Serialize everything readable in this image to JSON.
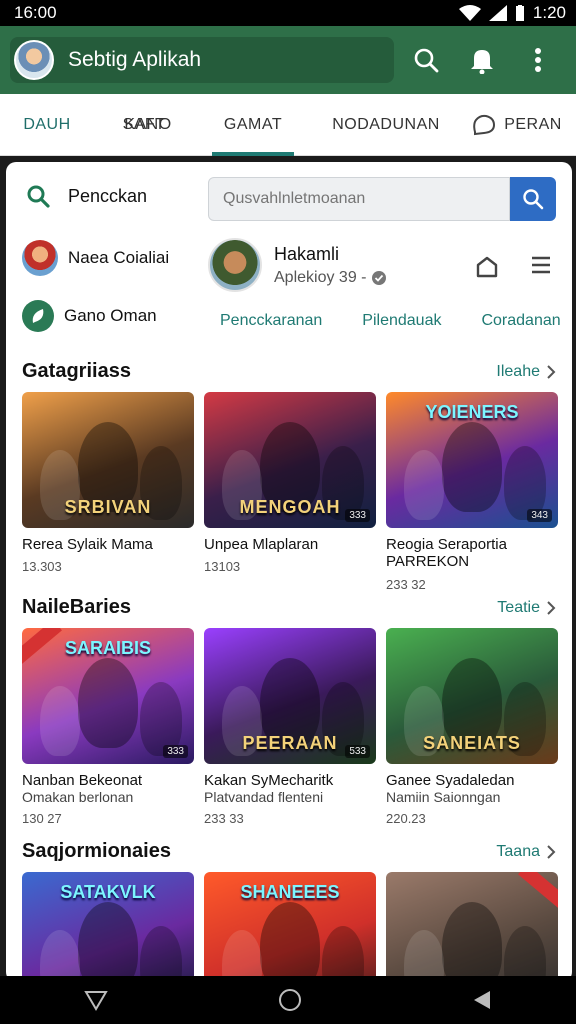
{
  "status": {
    "time": "16:00",
    "clock_right": "1:20"
  },
  "header": {
    "title": "Sebtig Aplikah"
  },
  "tabs": [
    {
      "label": "DAUH"
    },
    {
      "label": "KANO"
    },
    {
      "label": "SAFT"
    },
    {
      "label": "GAMAT"
    },
    {
      "label": "NODADUNAN"
    },
    {
      "label": "PERAN"
    }
  ],
  "search": {
    "label": "Pencckan",
    "placeholder": "Qusvahlnletmoanan"
  },
  "left_items": [
    {
      "label": "Naea Coialiai"
    },
    {
      "label": "Gano Oman"
    }
  ],
  "profile": {
    "name": "Hakamli",
    "subtitle": "Aplekioy 39 -"
  },
  "links": [
    "Pencckaranan",
    "Pilendauak",
    "Coradanan"
  ],
  "sections": [
    {
      "title": "Gatagriiass",
      "more": "Ileahe",
      "cards": [
        {
          "thumb_text": "SRBIVAN",
          "title": "Rerea Sylaik Mama",
          "subtitle": "",
          "meta": "13.303",
          "badge": "",
          "colors": [
            "#f0a04a",
            "#5a3a22",
            "#2a2a2a"
          ]
        },
        {
          "thumb_text": "MENGOAH",
          "title": "Unpea Mlaplaran",
          "subtitle": "",
          "meta": "13103",
          "badge": "333",
          "colors": [
            "#d43a44",
            "#3a1f4a",
            "#102040"
          ]
        },
        {
          "thumb_text": "",
          "thumb_top": "YOIENERS",
          "title": "Reogia Seraportia PARREKON",
          "subtitle": "",
          "meta": "233 32",
          "badge": "343",
          "colors": [
            "#ff8a2a",
            "#6a2aa0",
            "#1a5090"
          ]
        }
      ]
    },
    {
      "title": "NaileBaries",
      "more": "Teatie",
      "cards": [
        {
          "thumb_text": "",
          "thumb_top": "SARAIBIS",
          "title": "Nanban Bekeonat",
          "subtitle": "Omakan berlonan",
          "meta": "130 27",
          "badge": "333",
          "colors": [
            "#ff6a40",
            "#8a3ac0",
            "#2a1a60"
          ]
        },
        {
          "thumb_text": "PEERAAN",
          "title": "Kakan SyMecharitk",
          "subtitle": "Platvandad flenteni",
          "meta": "233 33",
          "badge": "533",
          "colors": [
            "#9a40ff",
            "#3a1a5a",
            "#1a3a1a"
          ]
        },
        {
          "thumb_text": "SANEIATS",
          "title": "Ganee Syadaledan",
          "subtitle": "Namiin Saionngan",
          "meta": "220.23",
          "badge": "",
          "colors": [
            "#4ab050",
            "#2a5a3a",
            "#6a3a1a"
          ]
        }
      ]
    },
    {
      "title": "Saqjormionaies",
      "more": "Taana",
      "cards": [
        {
          "thumb_text": "",
          "thumb_top": "SATAKVLK",
          "title": "",
          "subtitle": "",
          "meta": "",
          "badge": "",
          "colors": [
            "#3a6ad0",
            "#6a2aa0",
            "#101830"
          ]
        },
        {
          "thumb_text": "",
          "thumb_top": "SHANEEES",
          "title": "",
          "subtitle": "",
          "meta": "",
          "badge": "",
          "colors": [
            "#ff5a2a",
            "#d0302a",
            "#3a1a1a"
          ]
        },
        {
          "thumb_text": "",
          "title": "",
          "subtitle": "",
          "meta": "",
          "badge": "",
          "colors": [
            "#9a7a6a",
            "#5a4a40",
            "#2a2a2a"
          ]
        }
      ]
    }
  ],
  "theme": {
    "primary": "#2e6f48",
    "accent": "#1f7a73",
    "search_button": "#2e6cc4"
  }
}
